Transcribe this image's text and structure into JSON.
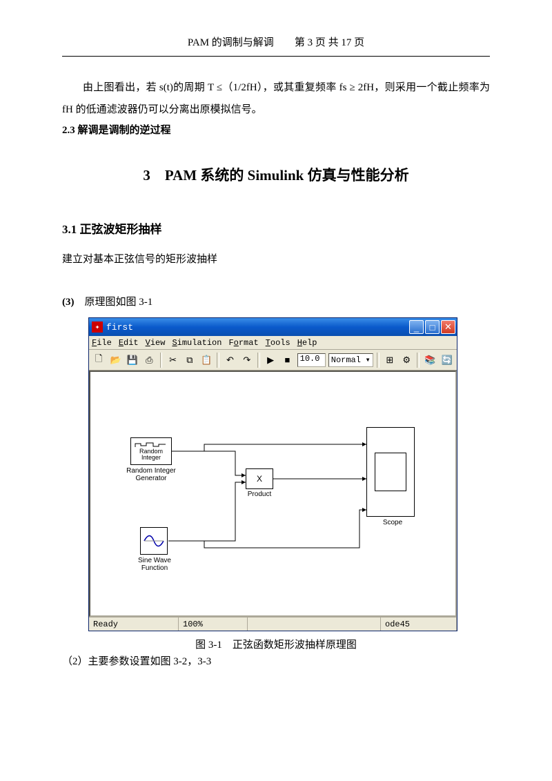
{
  "header": {
    "doc_title": "PAM 的调制与解调",
    "page_label": "第 3 页 共 17 页"
  },
  "body": {
    "para1": "由上图看出，若 s(t)的周期 T ≤（1/2fH），或其重复频率 fs ≥ 2fH，则采用一个截止频率为 fH 的低通滤波器仍可以分离出原模拟信号。",
    "sub23": "2.3 解调是调制的逆过程",
    "chapter3": "3　PAM 系统的 Simulink 仿真与性能分析",
    "sec31": "3.1 正弦波矩形抽样",
    "desc31": "建立对基本正弦信号的矩形波抽样",
    "item3_marker": "(3)",
    "item3_text": "原理图如图 3-1",
    "fig_caption": "图 3-1　正弦函数矩形波抽样原理图",
    "item2": "（2）主要参数设置如图 3-2，3-3"
  },
  "simulink": {
    "title": "first",
    "menu": {
      "file": "File",
      "edit": "Edit",
      "view": "View",
      "sim": "Simulation",
      "format": "Format",
      "tools": "Tools",
      "help": "Help"
    },
    "toolbar": {
      "time": "10.0",
      "mode": "Normal"
    },
    "blocks": {
      "random_line1": "Random",
      "random_line2": "Integer",
      "random_label": "Random Integer\nGenerator",
      "product": "X",
      "product_label": "Product",
      "sine_label": "Sine Wave\nFunction",
      "scope_label": "Scope"
    },
    "status": {
      "ready": "Ready",
      "zoom": "100%",
      "solver": "ode45"
    }
  }
}
